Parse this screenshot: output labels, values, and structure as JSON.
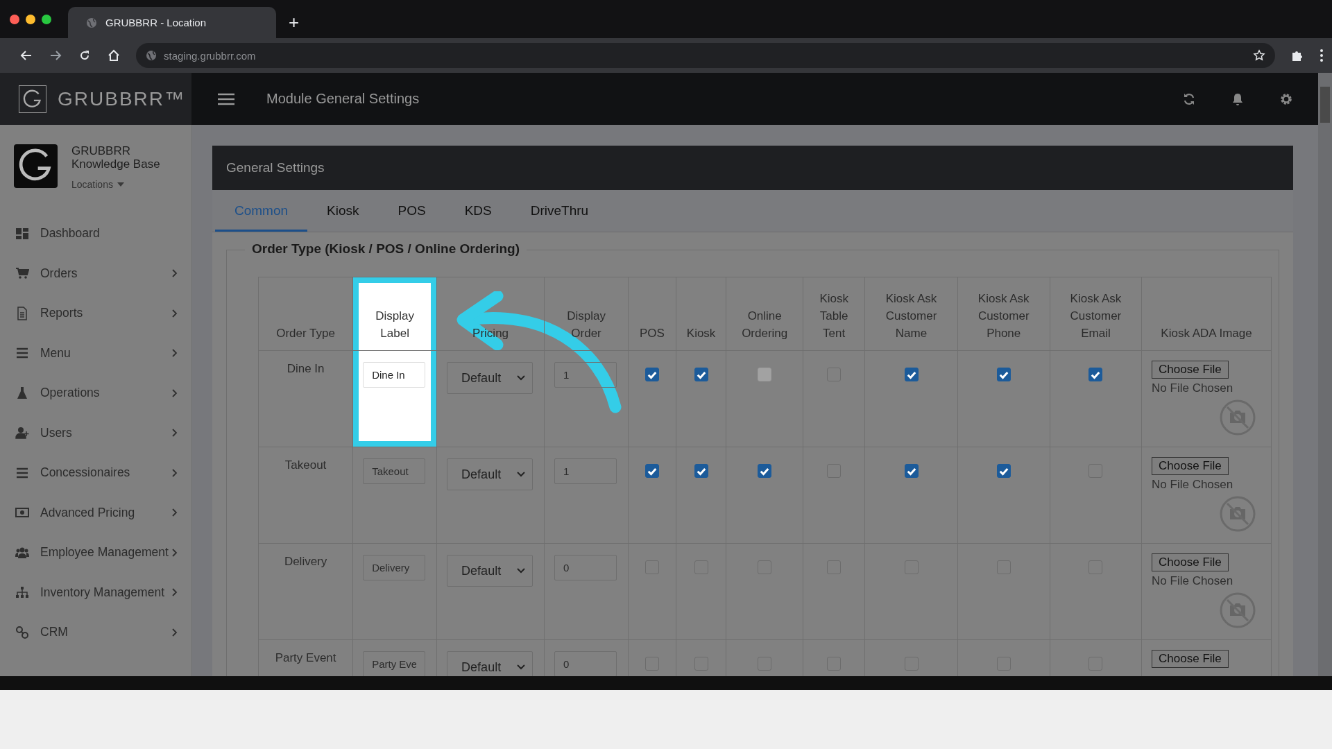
{
  "browser": {
    "tab_title": "GRUBBRR - Location",
    "new_tab": "+",
    "url": "staging.grubbrr.com"
  },
  "header": {
    "brand": "GRUBBRR™",
    "title": "Module General Settings"
  },
  "account": {
    "name": "GRUBBRR",
    "subtitle": "Knowledge Base",
    "location": "Locations"
  },
  "sidebar": {
    "items": [
      {
        "label": "Dashboard",
        "submenu": false
      },
      {
        "label": "Orders",
        "submenu": true
      },
      {
        "label": "Reports",
        "submenu": true
      },
      {
        "label": "Menu",
        "submenu": true
      },
      {
        "label": "Operations",
        "submenu": true
      },
      {
        "label": "Users",
        "submenu": true
      },
      {
        "label": "Concessionaires",
        "submenu": true
      },
      {
        "label": "Advanced Pricing",
        "submenu": true
      },
      {
        "label": "Employee Management",
        "submenu": true
      },
      {
        "label": "Inventory Management",
        "submenu": true
      },
      {
        "label": "CRM",
        "submenu": true
      }
    ]
  },
  "panel": {
    "title": "General Settings",
    "tabs": [
      {
        "label": "Common",
        "selected": true
      },
      {
        "label": "Kiosk",
        "selected": false
      },
      {
        "label": "POS",
        "selected": false
      },
      {
        "label": "KDS",
        "selected": false
      },
      {
        "label": "DriveThru",
        "selected": false
      }
    ],
    "section_title": "Order Type (Kiosk / POS / Online Ordering)",
    "table": {
      "columns": [
        {
          "label": "Order Type",
          "highlighted": false
        },
        {
          "label": "Display Label",
          "highlighted": true
        },
        {
          "label": "Pricing",
          "highlighted": false
        },
        {
          "label": "Display Order",
          "highlighted": false
        },
        {
          "label": "POS",
          "highlighted": false
        },
        {
          "label": "Kiosk",
          "highlighted": false
        },
        {
          "label": "Online Ordering",
          "highlighted": false
        },
        {
          "label": "Kiosk Table Tent",
          "highlighted": false
        },
        {
          "label": "Kiosk Ask Customer Name",
          "highlighted": false
        },
        {
          "label": "Kiosk Ask Customer Phone",
          "highlighted": false
        },
        {
          "label": "Kiosk Ask Customer Email",
          "highlighted": false
        },
        {
          "label": "Kiosk ADA Image",
          "highlighted": false
        }
      ],
      "rows": [
        {
          "order_type": "Dine In",
          "highlighted": true,
          "display_label": "Dine In",
          "pricing": "Default",
          "display_order": "1",
          "checks": [
            {
              "checked": true,
              "disabled": false
            },
            {
              "checked": true,
              "disabled": false
            },
            {
              "checked": false,
              "disabled": true
            },
            {
              "checked": false,
              "disabled": false
            },
            {
              "checked": true,
              "disabled": false
            },
            {
              "checked": true,
              "disabled": false
            },
            {
              "checked": true,
              "disabled": false
            }
          ],
          "file_button": "Choose File",
          "file_status": "No File Chosen"
        },
        {
          "order_type": "Takeout",
          "highlighted": false,
          "display_label": "Takeout",
          "pricing": "Default",
          "display_order": "1",
          "checks": [
            {
              "checked": true,
              "disabled": false
            },
            {
              "checked": true,
              "disabled": false
            },
            {
              "checked": true,
              "disabled": false
            },
            {
              "checked": false,
              "disabled": false
            },
            {
              "checked": true,
              "disabled": false
            },
            {
              "checked": true,
              "disabled": false
            },
            {
              "checked": false,
              "disabled": false
            }
          ],
          "file_button": "Choose File",
          "file_status": "No File Chosen"
        },
        {
          "order_type": "Delivery",
          "highlighted": false,
          "display_label": "Delivery",
          "pricing": "Default",
          "display_order": "0",
          "checks": [
            {
              "checked": false,
              "disabled": false
            },
            {
              "checked": false,
              "disabled": false
            },
            {
              "checked": false,
              "disabled": false
            },
            {
              "checked": false,
              "disabled": false
            },
            {
              "checked": false,
              "disabled": false
            },
            {
              "checked": false,
              "disabled": false
            },
            {
              "checked": false,
              "disabled": false
            }
          ],
          "file_button": "Choose File",
          "file_status": "No File Chosen"
        },
        {
          "order_type": "Party Event",
          "highlighted": false,
          "display_label": "Party Eve",
          "pricing": "Default",
          "display_order": "0",
          "checks": [
            {
              "checked": false,
              "disabled": false
            },
            {
              "checked": false,
              "disabled": false
            },
            {
              "checked": false,
              "disabled": false
            },
            {
              "checked": false,
              "disabled": false
            },
            {
              "checked": false,
              "disabled": false
            },
            {
              "checked": false,
              "disabled": false
            },
            {
              "checked": false,
              "disabled": false
            }
          ],
          "file_button": "Choose File"
        }
      ]
    }
  }
}
